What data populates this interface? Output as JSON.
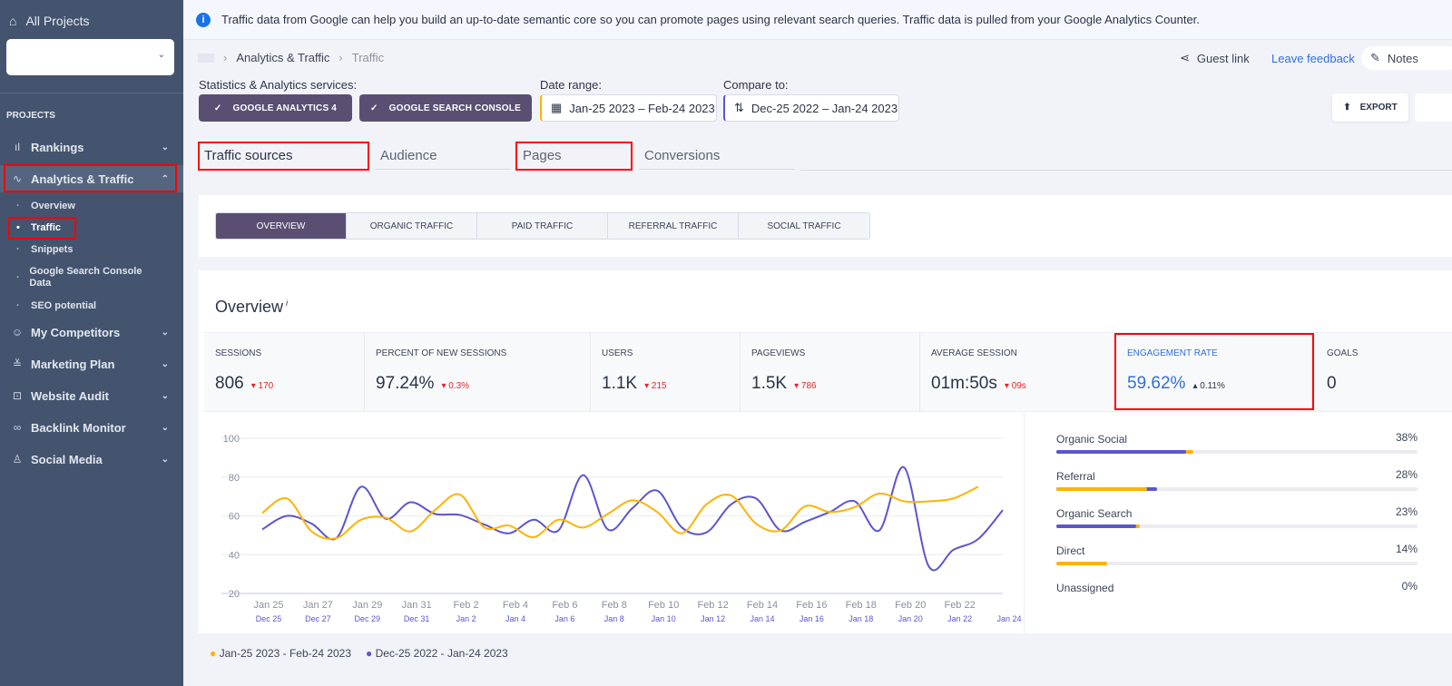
{
  "sidebar": {
    "all_projects": "All Projects",
    "section": "PROJECTS",
    "items": [
      {
        "label": "Rankings",
        "icon": "bar-chart-icon"
      },
      {
        "label": "Analytics & Traffic",
        "icon": "pulse-icon"
      },
      {
        "label": "My Competitors",
        "icon": "users-icon"
      },
      {
        "label": "Marketing Plan",
        "icon": "checklist-icon"
      },
      {
        "label": "Website Audit",
        "icon": "audit-icon"
      },
      {
        "label": "Backlink Monitor",
        "icon": "link-icon"
      },
      {
        "label": "Social Media",
        "icon": "thumbs-up-icon"
      }
    ],
    "subitems": [
      "Overview",
      "Traffic",
      "Snippets",
      "Google Search Console Data",
      "SEO potential"
    ]
  },
  "banner": "Traffic data from Google can help you build an up-to-date semantic core so you can promote pages using relevant search queries. Traffic data is pulled from your Google Analytics Counter.",
  "breadcrumb": [
    "Analytics & Traffic",
    "Traffic"
  ],
  "header": {
    "guest_link": "Guest link",
    "feedback": "Leave feedback",
    "notes": "Notes",
    "export": "EXPORT"
  },
  "filters": {
    "services_label": "Statistics & Analytics services:",
    "services": [
      "GOOGLE ANALYTICS 4",
      "GOOGLE SEARCH CONSOLE"
    ],
    "date_label": "Date range:",
    "date_value": "Jan-25 2023 – Feb-24 2023",
    "compare_label": "Compare to:",
    "compare_value": "Dec-25 2022 – Jan-24 2023"
  },
  "tabs": [
    "Traffic sources",
    "Audience",
    "Pages",
    "Conversions"
  ],
  "segments": [
    "OVERVIEW",
    "ORGANIC TRAFFIC",
    "PAID TRAFFIC",
    "REFERRAL TRAFFIC",
    "SOCIAL TRAFFIC"
  ],
  "overview": {
    "title": "Overview",
    "info_mark": "i",
    "metrics": [
      {
        "label": "SESSIONS",
        "value": "806",
        "change": "170",
        "dir": "down"
      },
      {
        "label": "PERCENT OF NEW SESSIONS",
        "value": "97.24%",
        "change": "0.3%",
        "dir": "down"
      },
      {
        "label": "USERS",
        "value": "1.1K",
        "change": "215",
        "dir": "down"
      },
      {
        "label": "PAGEVIEWS",
        "value": "1.5K",
        "change": "786",
        "dir": "down"
      },
      {
        "label": "AVERAGE SESSION",
        "value": "01m:50s",
        "change": "09s",
        "dir": "down"
      },
      {
        "label": "ENGAGEMENT RATE",
        "value": "59.62%",
        "change": "0.11%",
        "dir": "up"
      },
      {
        "label": "GOALS",
        "value": "0",
        "change": "",
        "dir": ""
      }
    ]
  },
  "sources": [
    {
      "name": "Organic Social",
      "pct": "38%",
      "current": 0.38,
      "previous": 0.36
    },
    {
      "name": "Referral",
      "pct": "28%",
      "current": 0.25,
      "previous": 0.28
    },
    {
      "name": "Organic Search",
      "pct": "23%",
      "current": 0.23,
      "previous": 0.22
    },
    {
      "name": "Direct",
      "pct": "14%",
      "current": 0.14,
      "previous": 0
    },
    {
      "name": "Unassigned",
      "pct": "0%",
      "current": 0,
      "previous": 0
    }
  ],
  "colors": {
    "current": "#ffb300",
    "previous": "#5b55d0",
    "accent": "#5a4f73",
    "sidebar": "#44546f",
    "link": "#2f6fdf"
  },
  "chart_data": {
    "type": "line",
    "ylim": [
      20,
      100
    ],
    "yticks": [
      20,
      40,
      60,
      80,
      100
    ],
    "grid": true,
    "xticks_primary": [
      "Jan 25",
      "Jan 27",
      "Jan 29",
      "Jan 31",
      "Feb 2",
      "Feb 4",
      "Feb 6",
      "Feb 8",
      "Feb 10",
      "Feb 12",
      "Feb 14",
      "Feb 16",
      "Feb 18",
      "Feb 20",
      "Feb 22",
      ""
    ],
    "xticks_secondary": [
      "Dec 25",
      "Dec 27",
      "Dec 29",
      "Dec 31",
      "Jan 2",
      "Jan 4",
      "Jan 6",
      "Jan 8",
      "Jan 10",
      "Jan 12",
      "Jan 14",
      "Jan 16",
      "Jan 18",
      "Jan 20",
      "Jan 22",
      "Jan 24"
    ],
    "series": [
      {
        "name": "Jan-25 2023 - Feb-24 2023",
        "color": "#ffb300",
        "values": [
          61.5,
          69,
          52,
          48.5,
          58,
          59,
          52,
          63,
          71,
          54,
          55,
          49,
          58,
          54,
          61,
          68,
          62,
          51,
          66,
          70.5,
          56,
          52.5,
          65,
          62,
          64.5,
          71.5,
          67.5,
          67.5,
          69,
          75
        ]
      },
      {
        "name": "Dec-25 2022 - Jan-24 2023",
        "color": "#5b55d0",
        "values": [
          53,
          60,
          56,
          48.5,
          75,
          58.5,
          67,
          61,
          60.5,
          55.5,
          51,
          58,
          52.5,
          81,
          53,
          64,
          73,
          54,
          51.5,
          66,
          69,
          52.5,
          57,
          62,
          67.5,
          52.5,
          85,
          34,
          42.5,
          48,
          63
        ]
      }
    ],
    "legend": "bottom-left"
  }
}
